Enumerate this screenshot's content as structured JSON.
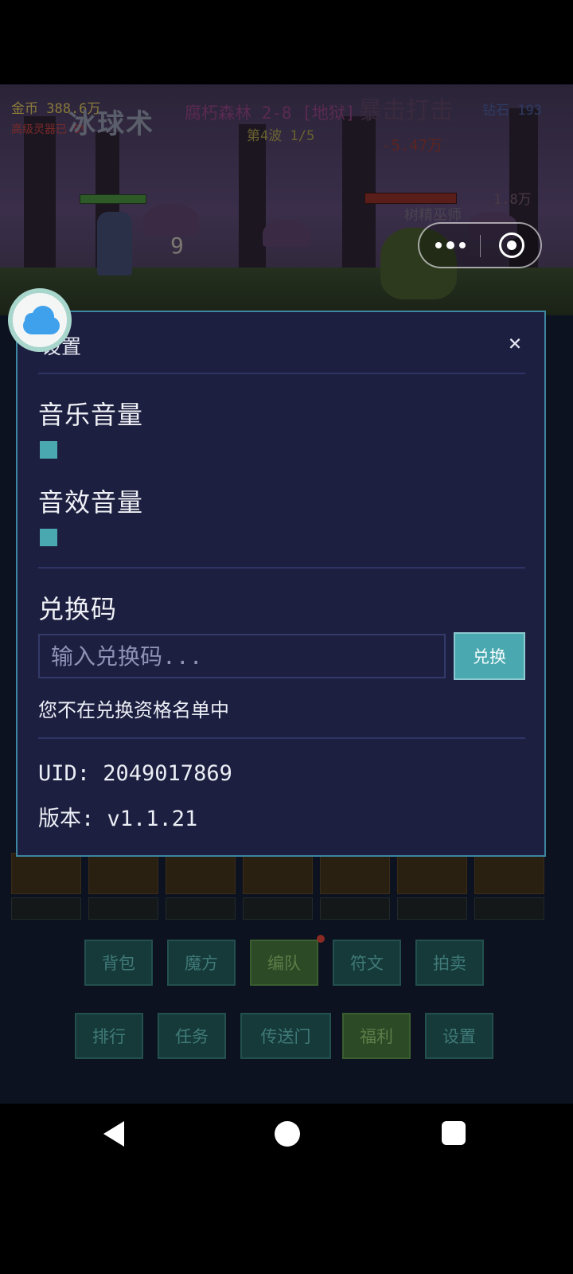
{
  "hud": {
    "gold": "金币 388.6万",
    "boost": "高级灵器已 9%",
    "spell": "冰球术",
    "stage": "腐朽森林 2-8 [地狱]",
    "wave": "第4波 1/5",
    "gem": "钻石 193",
    "strike": "暴击打击",
    "damage": "-5.47万",
    "hit_count": "9",
    "boss_hp": "1.8万",
    "boss_name": "树精巫师"
  },
  "modal": {
    "title": "设置",
    "close_glyph": "×",
    "music_label": "音乐音量",
    "music_volume": 0,
    "sfx_label": "音效音量",
    "sfx_volume": 0,
    "code_label": "兑换码",
    "code_value": "",
    "code_placeholder": "输入兑换码...",
    "redeem_label": "兑换",
    "status": "您不在兑换资格名单中",
    "uid": "UID: 2049017869",
    "version": "版本: v1.1.21"
  },
  "menu": {
    "row1": [
      "背包",
      "魔方",
      "编队",
      "符文",
      "拍卖"
    ],
    "row2": [
      "排行",
      "任务",
      "传送门",
      "福利",
      "设置"
    ]
  },
  "icons": {
    "cloud": "cloud-icon",
    "capsule_more": "more-dots-icon",
    "capsule_close": "target-icon",
    "nav_back": "back-triangle-icon",
    "nav_home": "home-circle-icon",
    "nav_recent": "recent-square-icon"
  },
  "colors": {
    "modal_bg": "#1c1f3f",
    "modal_border": "#3c86a0",
    "accent": "#4aa8b0",
    "cloud": "#3fa0ec"
  }
}
